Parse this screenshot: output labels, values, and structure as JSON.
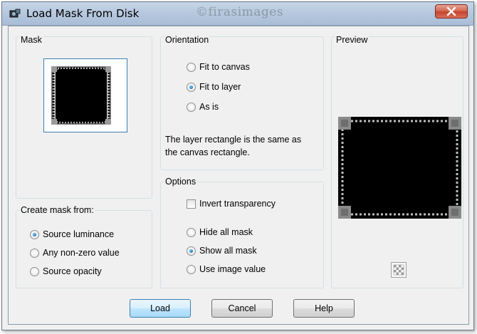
{
  "window": {
    "title": "Load Mask From Disk",
    "watermark": "©firasimages"
  },
  "mask_group": {
    "label": "Mask"
  },
  "create_mask_from": {
    "label": "Create mask from:",
    "options": [
      "Source luminance",
      "Any non-zero value",
      "Source opacity"
    ],
    "selected": "Source luminance"
  },
  "orientation": {
    "label": "Orientation",
    "options": [
      "Fit to canvas",
      "Fit to layer",
      "As is"
    ],
    "selected": "Fit to layer",
    "info_line1": "The layer rectangle is the same as",
    "info_line2": "the canvas rectangle."
  },
  "options": {
    "label": "Options",
    "invert_transparency": {
      "label": "Invert transparency",
      "checked": false
    },
    "mask_display": [
      "Hide all mask",
      "Show all mask",
      "Use image value"
    ],
    "selected": "Show all mask"
  },
  "preview": {
    "label": "Preview"
  },
  "buttons": {
    "load": "Load",
    "cancel": "Cancel",
    "help": "Help"
  },
  "icons": {
    "app": "mask-app-icon",
    "close": "close-icon",
    "background": "transparency-checker-icon"
  },
  "colors": {
    "titlebar": "#b7c9df",
    "close_button": "#c7432d",
    "radio_selected": "#1d7fc0",
    "default_button_border": "#3c7fb1",
    "dialog_bg": "#f0f0f0"
  }
}
